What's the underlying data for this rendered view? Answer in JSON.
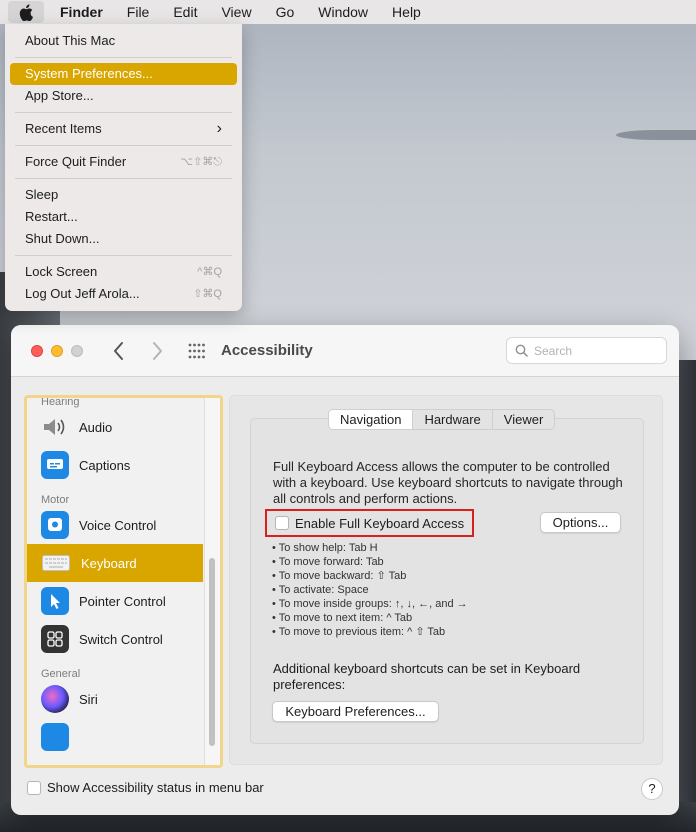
{
  "menubar": {
    "apple_icon": "apple-icon",
    "app": "Finder",
    "items": [
      "File",
      "Edit",
      "View",
      "Go",
      "Window",
      "Help"
    ]
  },
  "apple_menu": {
    "items": [
      {
        "label": "About This Mac",
        "shortcut": ""
      },
      {
        "label": "System Preferences...",
        "shortcut": "",
        "selected": true
      },
      {
        "label": "App Store...",
        "shortcut": ""
      },
      {
        "label": "Recent Items",
        "shortcut": "›"
      },
      {
        "label": "Force Quit Finder",
        "shortcut": "⌥⇧⌘⎋"
      },
      {
        "label": "Sleep",
        "shortcut": ""
      },
      {
        "label": "Restart...",
        "shortcut": ""
      },
      {
        "label": "Shut Down...",
        "shortcut": ""
      },
      {
        "label": "Lock Screen",
        "shortcut": "^⌘Q"
      },
      {
        "label": "Log Out Jeff Arola...",
        "shortcut": "⇧⌘Q"
      }
    ],
    "accent": "#d9a600"
  },
  "window": {
    "title": "Accessibility",
    "search_placeholder": "Search"
  },
  "sidebar": {
    "sections": {
      "hearing": "Hearing",
      "motor": "Motor",
      "general": "General"
    },
    "items": {
      "audio": "Audio",
      "captions": "Captions",
      "voice_control": "Voice Control",
      "keyboard": "Keyboard",
      "pointer_control": "Pointer Control",
      "switch_control": "Switch Control",
      "siri": "Siri"
    },
    "selected": "Keyboard"
  },
  "main": {
    "tabs": [
      "Navigation",
      "Hardware",
      "Viewer"
    ],
    "active_tab": "Navigation",
    "description": "Full Keyboard Access allows the computer to be controlled with a keyboard. Use keyboard shortcuts to navigate through all controls and perform actions.",
    "enable_label": "Enable Full Keyboard Access",
    "options_label": "Options...",
    "tips": [
      "To show help: Tab H",
      "To move forward: Tab",
      "To move backward: ⇧ Tab",
      "To activate: Space",
      "To move inside groups: ↑, ↓, ←, and →",
      "To move to next item: ^ Tab",
      "To move to previous item: ^ ⇧ Tab"
    ],
    "additional": "Additional keyboard shortcuts can be set in Keyboard preferences:",
    "kb_prefs_label": "Keyboard Preferences..."
  },
  "footer": {
    "status_label": "Show Accessibility status in menu bar",
    "help_label": "?"
  }
}
